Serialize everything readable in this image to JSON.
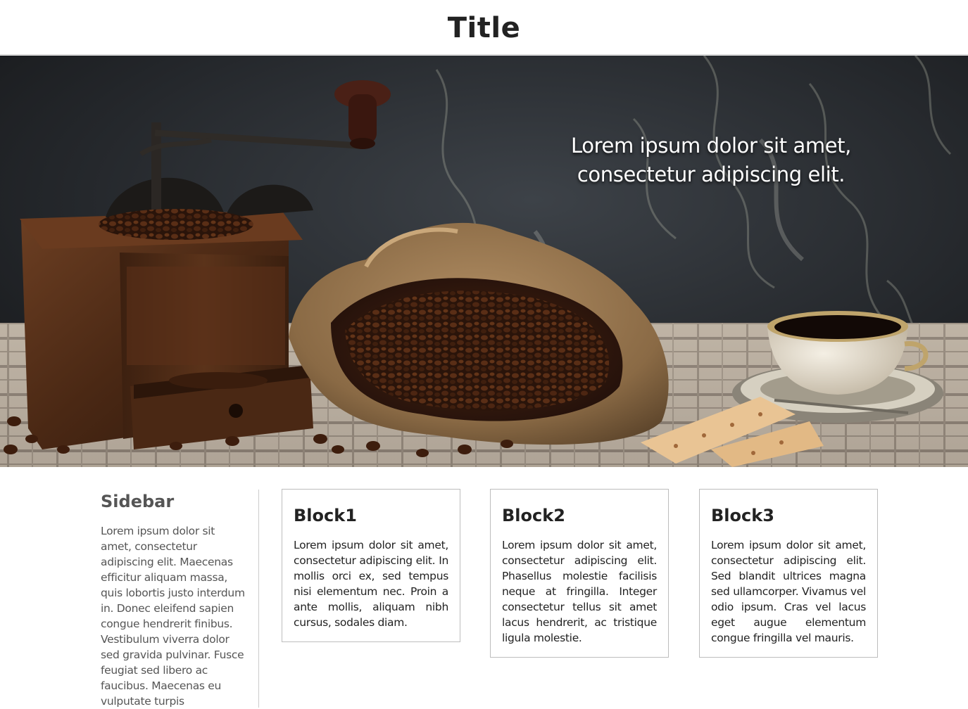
{
  "header": {
    "title": "Title"
  },
  "hero": {
    "caption_line1": "Lorem ipsum dolor sit amet,",
    "caption_line2": "consectetur adipiscing elit.",
    "image": "coffee-grinder-beans-cup-photo"
  },
  "sidebar": {
    "title": "Sidebar",
    "text": "Lorem ipsum dolor sit amet, consectetur adipiscing elit. Maecenas efficitur aliquam massa, quis lobortis justo interdum in. Donec eleifend sapien congue hendrerit finibus. Vestibulum viverra dolor sed gravida pulvinar. Fusce feugiat sed libero ac faucibus. Maecenas eu vulputate turpis"
  },
  "blocks": [
    {
      "title": "Block1",
      "text": "Lorem ipsum dolor sit amet, consectetur adipiscing elit. In mollis orci ex, sed tempus nisi elementum nec. Proin a ante mollis, aliquam nibh cursus, sodales diam."
    },
    {
      "title": "Block2",
      "text": "Lorem ipsum dolor sit amet, consectetur adipiscing elit. Phasellus molestie facilisis neque at fringilla. Integer consectetur tellus sit amet lacus hendrerit, ac tristique ligula molestie."
    },
    {
      "title": "Block3",
      "text": "Lorem ipsum dolor sit amet, consectetur adipiscing elit. Sed blandit ultrices magna sed ullamcorper. Vivamus vel odio ipsum. Cras vel lacus eget augue elementum congue fringilla vel mauris."
    }
  ]
}
